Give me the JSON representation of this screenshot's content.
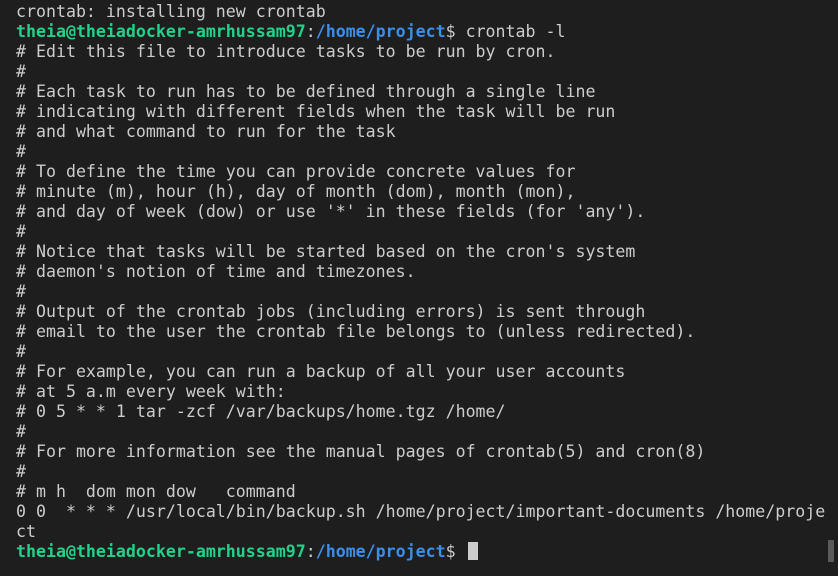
{
  "lines": [
    {
      "text": "crontab: installing new crontab"
    },
    {
      "prompt": {
        "user": "theia@theiadocker-amrhussam97",
        "sep": ":",
        "path": "/home/project",
        "symbol": "$ "
      },
      "text": "crontab -l"
    },
    {
      "text": "# Edit this file to introduce tasks to be run by cron."
    },
    {
      "text": "#"
    },
    {
      "text": "# Each task to run has to be defined through a single line"
    },
    {
      "text": "# indicating with different fields when the task will be run"
    },
    {
      "text": "# and what command to run for the task"
    },
    {
      "text": "#"
    },
    {
      "text": "# To define the time you can provide concrete values for"
    },
    {
      "text": "# minute (m), hour (h), day of month (dom), month (mon),"
    },
    {
      "text": "# and day of week (dow) or use '*' in these fields (for 'any')."
    },
    {
      "text": "#"
    },
    {
      "text": "# Notice that tasks will be started based on the cron's system"
    },
    {
      "text": "# daemon's notion of time and timezones."
    },
    {
      "text": "#"
    },
    {
      "text": "# Output of the crontab jobs (including errors) is sent through"
    },
    {
      "text": "# email to the user the crontab file belongs to (unless redirected)."
    },
    {
      "text": "#"
    },
    {
      "text": "# For example, you can run a backup of all your user accounts"
    },
    {
      "text": "# at 5 a.m every week with:"
    },
    {
      "text": "# 0 5 * * 1 tar -zcf /var/backups/home.tgz /home/"
    },
    {
      "text": "#"
    },
    {
      "text": "# For more information see the manual pages of crontab(5) and cron(8)"
    },
    {
      "text": "#"
    },
    {
      "text": "# m h  dom mon dow   command"
    },
    {
      "text": "0 0  * * * /usr/local/bin/backup.sh /home/project/important-documents /home/proje"
    },
    {
      "text": "ct"
    },
    {
      "prompt": {
        "user": "theia@theiadocker-amrhussam97",
        "sep": ":",
        "path": "/home/project",
        "symbol": "$ "
      },
      "text": "",
      "cursor": true
    }
  ],
  "colors": {
    "background": "#1e1e1e",
    "foreground": "#cccccc",
    "prompt_user": "#23d18b",
    "prompt_path": "#3b8eea"
  }
}
